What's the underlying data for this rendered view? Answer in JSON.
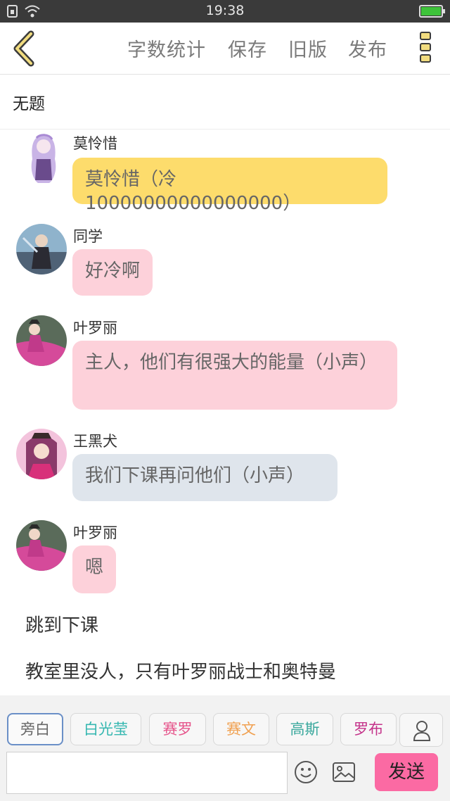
{
  "status_bar": {
    "time": "19:38",
    "battery_color": "#3ec33a"
  },
  "toolbar": {
    "back_icon": "chevron-left-icon",
    "word_count_label": "字数统计",
    "save_label": "保存",
    "old_version_label": "旧版",
    "publish_label": "发布",
    "menu_icon": "more-vertical-icon"
  },
  "document": {
    "title": "无题"
  },
  "messages": [
    {
      "name": "莫怜惜",
      "text": "莫怜惜（冷10000000000000000）",
      "bubble_color": "#fddc6c"
    },
    {
      "name": "同学",
      "text": "好冷啊",
      "bubble_color": "#fdd1da"
    },
    {
      "name": "叶罗丽",
      "text": "主人，他们有很强大的能量（小声）",
      "bubble_color": "#fdd1da"
    },
    {
      "name": "王黑犬",
      "text": "我们下课再问他们（小声）",
      "bubble_color": "#dfe5ec"
    },
    {
      "name": "叶罗丽",
      "text": "嗯",
      "bubble_color": "#fdd1da"
    }
  ],
  "narration": [
    "跳到下课",
    "教室里没人，只有叶罗丽战士和奥特曼"
  ],
  "characters": [
    {
      "label": "旁白",
      "color": "#666666",
      "selected": true
    },
    {
      "label": "白光莹",
      "color": "#35b7b0"
    },
    {
      "label": "赛罗",
      "color": "#e6548b"
    },
    {
      "label": "赛文",
      "color": "#f0a050"
    },
    {
      "label": "高斯",
      "color": "#3aa89d"
    },
    {
      "label": "罗布",
      "color": "#c4338a"
    }
  ],
  "input": {
    "value": "",
    "placeholder": ""
  },
  "actions": {
    "send_label": "发送",
    "emoji_icon": "smiley-icon",
    "image_icon": "image-icon",
    "person_icon": "person-icon"
  }
}
